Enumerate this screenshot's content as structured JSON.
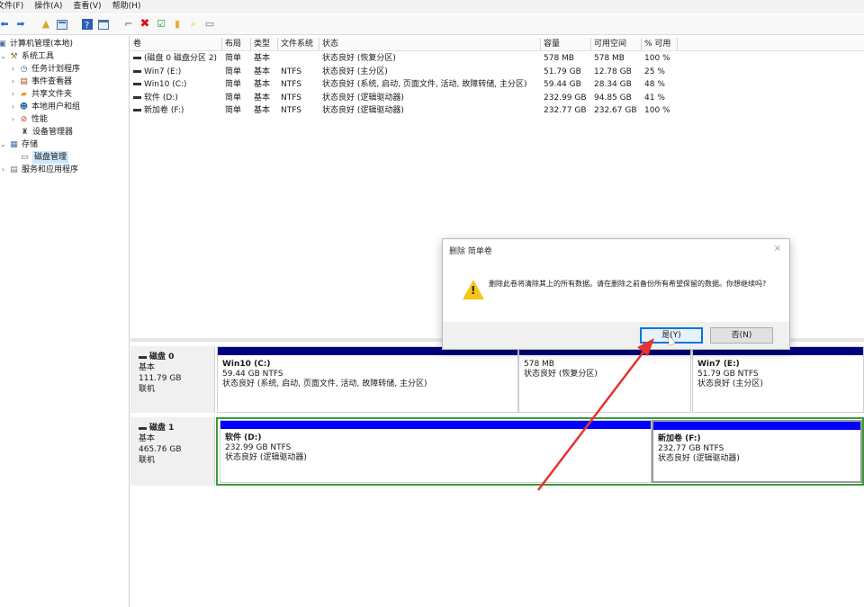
{
  "menu": [
    "文件(F)",
    "操作(A)",
    "查看(V)",
    "帮助(H)"
  ],
  "toolbar_icons": [
    "back-icon",
    "forward-icon",
    "folder-up-icon",
    "properties-icon",
    "help-icon",
    "console-icon",
    "connect-icon",
    "delete-icon",
    "check-icon",
    "folder-icon",
    "search-folder-icon",
    "window-icon"
  ],
  "tree": {
    "root": "计算机管理(本地)",
    "system_tools": "系统工具",
    "task_scheduler": "任务计划程序",
    "event_viewer": "事件查看器",
    "shared_folders": "共享文件夹",
    "local_users": "本地用户和组",
    "performance": "性能",
    "device_manager": "设备管理器",
    "storage": "存储",
    "disk_management": "磁盘管理",
    "services": "服务和应用程序"
  },
  "table": {
    "columns": [
      "卷",
      "布局",
      "类型",
      "文件系统",
      "状态",
      "容量",
      "可用空间",
      "% 可用"
    ],
    "rows": [
      [
        "(磁盘 0 磁盘分区 2)",
        "简单",
        "基本",
        "",
        "状态良好 (恢复分区)",
        "578 MB",
        "578 MB",
        "100 %"
      ],
      [
        "Win7 (E:)",
        "简单",
        "基本",
        "NTFS",
        "状态良好 (主分区)",
        "51.79 GB",
        "12.78 GB",
        "25 %"
      ],
      [
        "Win10 (C:)",
        "简单",
        "基本",
        "NTFS",
        "状态良好 (系统, 启动, 页面文件, 活动, 故障转储, 主分区)",
        "59.44 GB",
        "28.34 GB",
        "48 %"
      ],
      [
        "软件 (D:)",
        "简单",
        "基本",
        "NTFS",
        "状态良好 (逻辑驱动器)",
        "232.99 GB",
        "94.85 GB",
        "41 %"
      ],
      [
        "新加卷 (F:)",
        "简单",
        "基本",
        "NTFS",
        "状态良好 (逻辑驱动器)",
        "232.77 GB",
        "232.67 GB",
        "100 %"
      ]
    ]
  },
  "disks": [
    {
      "name": "磁盘 0",
      "type": "基本",
      "size": "111.79 GB",
      "status": "联机",
      "partitions": [
        {
          "name": "Win10  (C:)",
          "size": "59.44 GB NTFS",
          "status": "状态良好 (系统, 启动, 页面文件, 活动, 故障转储, 主分区)"
        },
        {
          "name": "",
          "size": "578 MB",
          "status": "状态良好 (恢复分区)"
        },
        {
          "name": "Win7  (E:)",
          "size": "51.79 GB NTFS",
          "status": "状态良好 (主分区)"
        }
      ]
    },
    {
      "name": "磁盘 1",
      "type": "基本",
      "size": "465.76 GB",
      "status": "联机",
      "partitions": [
        {
          "name": "软件  (D:)",
          "size": "232.99 GB NTFS",
          "status": "状态良好 (逻辑驱动器)"
        },
        {
          "name": "新加卷  (F:)",
          "size": "232.77 GB NTFS",
          "status": "状态良好 (逻辑驱动器)"
        }
      ]
    }
  ],
  "dialog": {
    "title": "删除 简单卷",
    "message": "删除此卷将清除其上的所有数据。请在删除之前备份所有希望保留的数据。你想继续吗?",
    "yes": "是(Y)",
    "no": "否(N)",
    "close": "×"
  },
  "colors": {
    "primary_bar": "#000080",
    "logical_bar": "#0000ff",
    "extended_border": "#3a9a3a",
    "annotation_arrow": "#e8322e"
  }
}
